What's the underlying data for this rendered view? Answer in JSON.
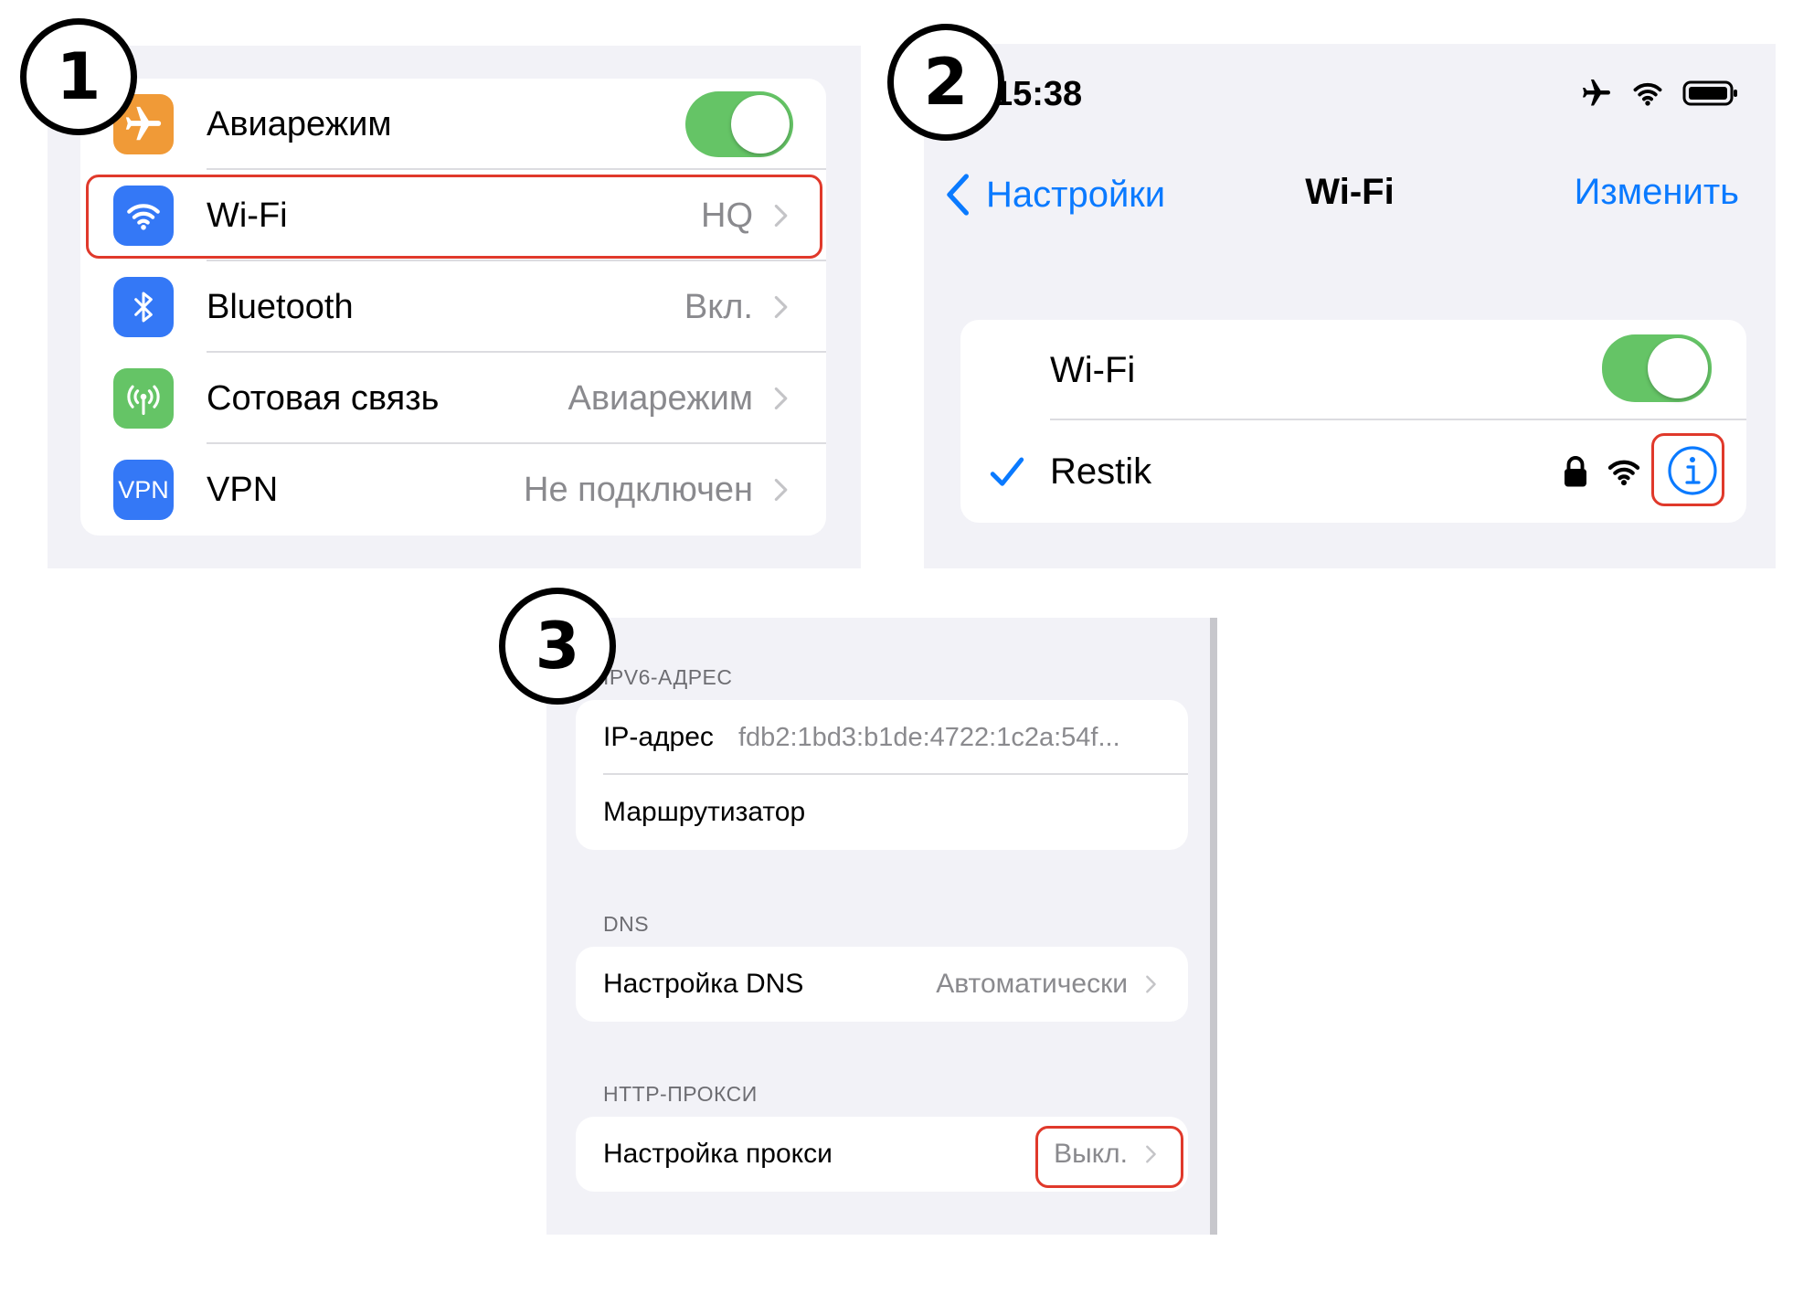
{
  "steps": [
    "1",
    "2",
    "3"
  ],
  "panel1": {
    "rows": [
      {
        "label": "Авиарежим",
        "icon": "airplane-icon",
        "icon_color": "#f09a37"
      },
      {
        "label": "Wi-Fi",
        "value": "HQ",
        "icon": "wifi-icon",
        "icon_color": "#3478f6"
      },
      {
        "label": "Bluetooth",
        "value": "Вкл.",
        "icon": "bluetooth-icon",
        "icon_color": "#3478f6"
      },
      {
        "label": "Сотовая связь",
        "value": "Авиарежим",
        "icon": "antenna-icon",
        "icon_color": "#65c466"
      },
      {
        "label": "VPN",
        "value": "Не подключен",
        "icon": "vpn-icon",
        "icon_text": "VPN",
        "icon_color": "#3478f6"
      }
    ],
    "airplane_toggle_on": true
  },
  "panel2": {
    "time": "15:38",
    "nav": {
      "back_label": "Настройки",
      "title": "Wi-Fi",
      "edit_label": "Изменить"
    },
    "wifi_label": "Wi-Fi",
    "wifi_toggle_on": true,
    "network": {
      "name": "Restik",
      "connected": true,
      "locked": true
    }
  },
  "panel3": {
    "ipv6_header": "IPV6-АДРЕС",
    "ip_label": "IP-адрес",
    "ip_value": "fdb2:1bd3:b1de:4722:1c2a:54f...",
    "router_label": "Маршрутизатор",
    "dns_header": "DNS",
    "dns_label": "Настройка DNS",
    "dns_value": "Автоматически",
    "proxy_header": "HTTP-ПРОКСИ",
    "proxy_label": "Настройка прокси",
    "proxy_value": "Выкл."
  },
  "colors": {
    "accent": "#0a7aff",
    "toggle_on": "#65c466",
    "highlight": "#e0392b",
    "background": "#f2f2f7"
  }
}
